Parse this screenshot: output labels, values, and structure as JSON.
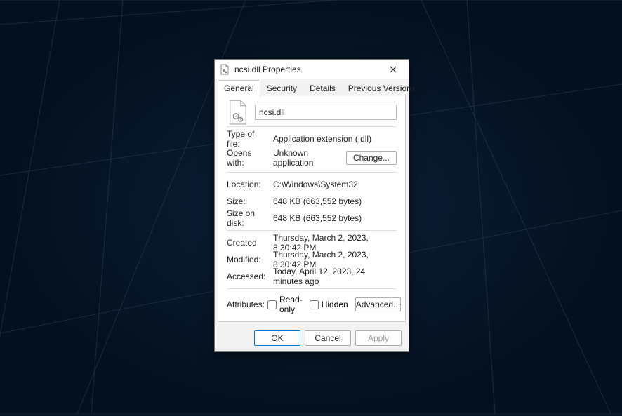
{
  "titlebar": {
    "title": "ncsi.dll Properties"
  },
  "tabs": {
    "general": "General",
    "security": "Security",
    "details": "Details",
    "previous_versions": "Previous Versions"
  },
  "filename": "ncsi.dll",
  "fields": {
    "type_label": "Type of file:",
    "type_value": "Application extension (.dll)",
    "opens_label": "Opens with:",
    "opens_value": "Unknown application",
    "change_btn": "Change...",
    "location_label": "Location:",
    "location_value": "C:\\Windows\\System32",
    "size_label": "Size:",
    "size_value": "648 KB (663,552 bytes)",
    "disk_label": "Size on disk:",
    "disk_value": "648 KB (663,552 bytes)",
    "created_label": "Created:",
    "created_value": "Thursday, March 2, 2023, 8:30:42 PM",
    "modified_label": "Modified:",
    "modified_value": "Thursday, March 2, 2023, 8:30:42 PM",
    "accessed_label": "Accessed:",
    "accessed_value": "Today, April 12, 2023, 24 minutes ago",
    "attributes_label": "Attributes:",
    "readonly_label": "Read-only",
    "hidden_label": "Hidden",
    "advanced_btn": "Advanced..."
  },
  "footer": {
    "ok": "OK",
    "cancel": "Cancel",
    "apply": "Apply"
  }
}
